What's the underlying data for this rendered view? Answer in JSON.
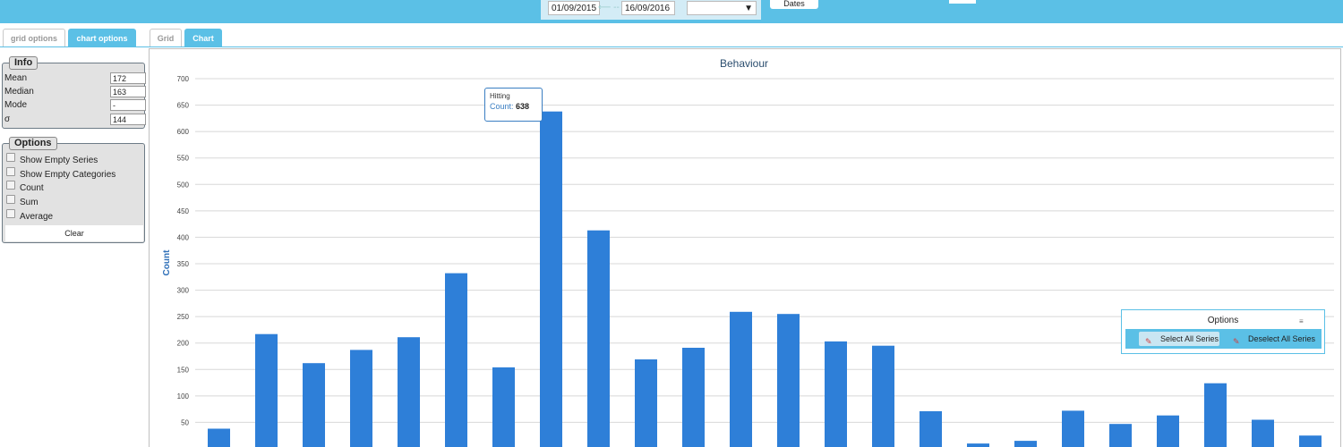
{
  "header": {
    "date_from": "01/09/2015",
    "date_to": "16/09/2016",
    "select_value": "",
    "dates_button": "Dates"
  },
  "tabs": {
    "left": [
      {
        "label": "grid options",
        "active": false
      },
      {
        "label": "chart options",
        "active": true
      }
    ],
    "right": [
      {
        "label": "Grid",
        "active": false
      },
      {
        "label": "Chart",
        "active": true
      }
    ]
  },
  "info": {
    "legend": "Info",
    "rows": [
      {
        "label": "Mean",
        "value": "172"
      },
      {
        "label": "Median",
        "value": "163"
      },
      {
        "label": "Mode",
        "value": "-"
      },
      {
        "label": "σ",
        "value": "144"
      }
    ]
  },
  "options": {
    "legend": "Options",
    "items": [
      "Show Empty Series",
      "Show Empty Categories",
      "Count",
      "Sum",
      "Average"
    ],
    "clear_label": "Clear"
  },
  "tooltip": {
    "title": "Hitting",
    "label": "Count:",
    "value": "638"
  },
  "series_options": {
    "title": "Options",
    "close": "≡",
    "select_all": "Select All Series",
    "deselect_all": "Deselect All Series"
  },
  "colors": {
    "topbar": "#5bc0e6",
    "bar": "#2e7fd8",
    "axis_title": "#2e6fb8"
  },
  "chart_data": {
    "type": "bar",
    "title": "Behaviour",
    "xlabel": "",
    "ylabel": "Count",
    "ylim": [
      0,
      700
    ],
    "yticks": [
      50,
      100,
      150,
      200,
      250,
      300,
      350,
      400,
      450,
      500,
      550,
      600,
      650,
      700
    ],
    "grid": true,
    "values": [
      38,
      217,
      162,
      187,
      211,
      332,
      154,
      638,
      413,
      169,
      191,
      259,
      255,
      203,
      195,
      71,
      10,
      15,
      72,
      47,
      63,
      124,
      55,
      25
    ]
  }
}
